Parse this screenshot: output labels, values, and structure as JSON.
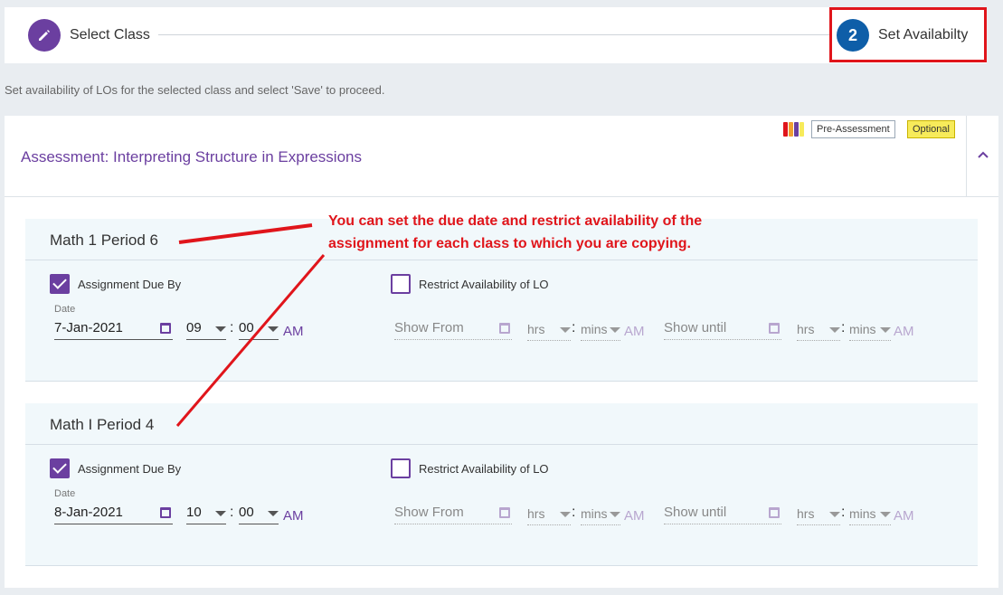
{
  "stepper": {
    "step1": {
      "label": "Select Class"
    },
    "step2": {
      "number": "2",
      "label": "Set Availabilty"
    }
  },
  "instruction": "Set availability of LOs for the selected class and select 'Save' to proceed.",
  "assessment": {
    "title": "Assessment: Interpreting Structure in Expressions",
    "badge_type": "Pre-Assessment",
    "badge_optional": "Optional",
    "icon_colors": [
      "#e0151b",
      "#f0a030",
      "#6b3fa0",
      "#f7eb5a"
    ]
  },
  "annotation": {
    "line1": "You can set the due date and restrict availability of the",
    "line2": "assignment for each class to which you are copying."
  },
  "classes": [
    {
      "name": "Math 1 Period 6",
      "due_label": "Assignment Due By",
      "due_checked": true,
      "date_label": "Date",
      "date": "7-Jan-2021",
      "hour": "09",
      "minute": "00",
      "ampm": "AM",
      "restrict_label": "Restrict Availability of LO",
      "restrict_checked": false,
      "show_from": "Show From",
      "show_until": "Show until",
      "hrs": "hrs",
      "mins": "mins",
      "ampm_dim": "AM"
    },
    {
      "name": "Math I Period 4",
      "due_label": "Assignment Due By",
      "due_checked": true,
      "date_label": "Date",
      "date": "8-Jan-2021",
      "hour": "10",
      "minute": "00",
      "ampm": "AM",
      "restrict_label": "Restrict Availability of LO",
      "restrict_checked": false,
      "show_from": "Show From",
      "show_until": "Show until",
      "hrs": "hrs",
      "mins": "mins",
      "ampm_dim": "AM"
    }
  ],
  "colors": {
    "accent_purple": "#6b3fa0",
    "step_blue": "#0e5ea8",
    "annotation_red": "#e0151b",
    "optional_yellow": "#f7eb5a"
  }
}
